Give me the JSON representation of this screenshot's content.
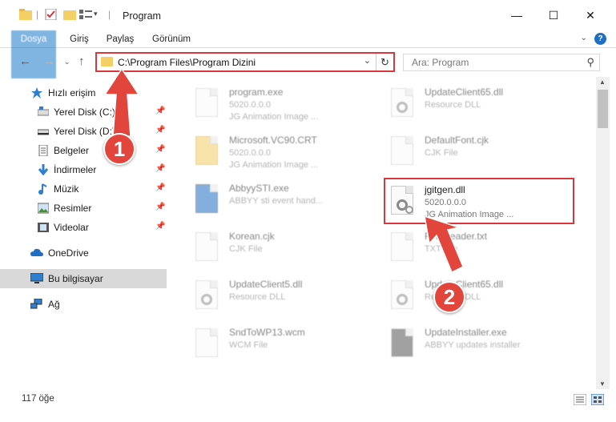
{
  "window": {
    "title": "Program",
    "minimize": "—",
    "maximize": "☐",
    "close": "✕"
  },
  "ribbon": {
    "tabs": [
      "Dosya",
      "Giriş",
      "Paylaş",
      "Görünüm"
    ],
    "help": "?"
  },
  "address": {
    "path": "C:\\Program Files\\Program Dizini",
    "search_placeholder": "Ara: Program"
  },
  "sidebar": {
    "items": [
      {
        "label": "Hızlı erişim",
        "icon": "star-icon",
        "pinned": false
      },
      {
        "label": "Yerel Disk (C:)",
        "icon": "drive-icon",
        "pinned": true
      },
      {
        "label": "Yerel Disk (D:)",
        "icon": "drive-icon",
        "pinned": true
      },
      {
        "label": "Belgeler",
        "icon": "documents-icon",
        "pinned": true
      },
      {
        "label": "İndirmeler",
        "icon": "download-icon",
        "pinned": true
      },
      {
        "label": "Müzik",
        "icon": "music-icon",
        "pinned": true
      },
      {
        "label": "Resimler",
        "icon": "pictures-icon",
        "pinned": true
      },
      {
        "label": "Videolar",
        "icon": "videos-icon",
        "pinned": true
      },
      {
        "label": "OneDrive",
        "icon": "cloud-icon",
        "pinned": false
      },
      {
        "label": "Bu bilgisayar",
        "icon": "computer-icon",
        "pinned": false
      },
      {
        "label": "Ağ",
        "icon": "network-icon",
        "pinned": false
      }
    ]
  },
  "files": [
    {
      "name": "program.exe",
      "line2": "5020.0.0.0",
      "line3": "JG Animation Image ..."
    },
    {
      "name": "UpdateClient65.dll",
      "line2": "Resource DLL",
      "line3": ""
    },
    {
      "name": "Microsoft.VC90.CRT",
      "line2": "5020.0.0.0",
      "line3": "JG Animation Image ..."
    },
    {
      "name": "DefaultFont.cjk",
      "line2": "CJK File",
      "line3": ""
    },
    {
      "name": "AbbyySTI.exe",
      "line2": "ABBYY sti event hand...",
      "line3": ""
    },
    {
      "name": "jgitgen.dll",
      "line2": "5020.0.0.0",
      "line3": "JG Animation Image ..."
    },
    {
      "name": "Korean.cjk",
      "line2": "CJK File",
      "line3": ""
    },
    {
      "name": "FineReader.txt",
      "line2": "TXT File",
      "line3": ""
    },
    {
      "name": "UpdateClient5.dll",
      "line2": "Resource DLL",
      "line3": ""
    },
    {
      "name": "UpdateClient65.dll",
      "line2": "Resource DLL",
      "line3": ""
    },
    {
      "name": "SndToWP13.wcm",
      "line2": "WCM File",
      "line3": ""
    },
    {
      "name": "UpdateInstaller.exe",
      "line2": "ABBYY updates installer",
      "line3": ""
    }
  ],
  "status": {
    "count": "117 öğe"
  },
  "callouts": {
    "one": "1",
    "two": "2"
  },
  "colors": {
    "accent": "#1979ca",
    "highlight": "#d9363e",
    "callout": "#e2453c"
  }
}
